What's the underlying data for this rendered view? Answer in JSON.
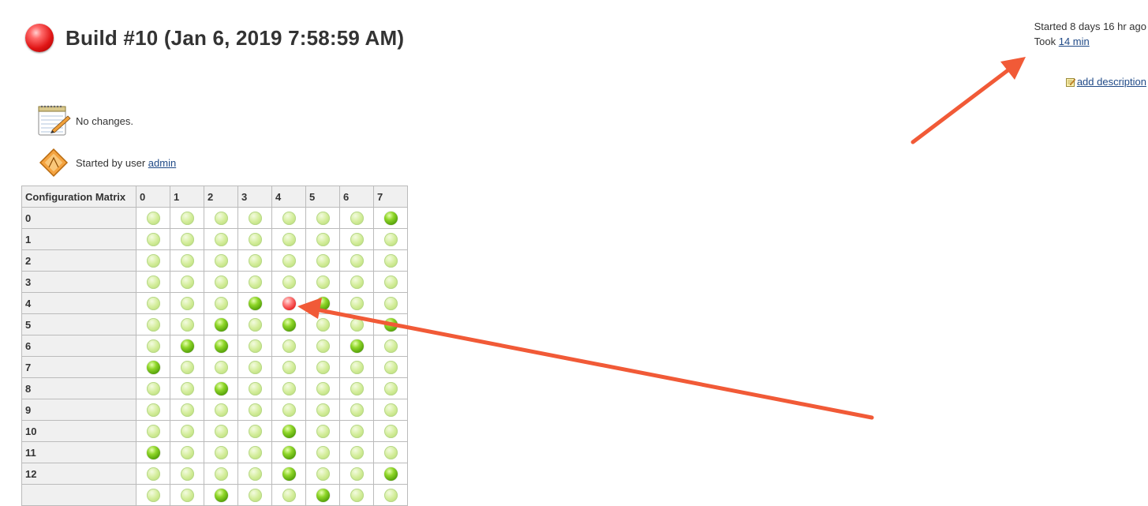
{
  "build": {
    "title": "Build #10 (Jan 6, 2019 7:58:59 AM)",
    "status": "failed",
    "started": "Started 8 days 16 hr ago",
    "took_prefix": "Took",
    "duration": "14 min",
    "add_description": "add description"
  },
  "changes": {
    "text": "No changes.",
    "icon": "notepad-icon"
  },
  "cause": {
    "prefix": "Started by user",
    "user": "admin",
    "icon": "user-cause-icon"
  },
  "matrix": {
    "corner_label": "Configuration Matrix",
    "columns": [
      "0",
      "1",
      "2",
      "3",
      "4",
      "5",
      "6",
      "7"
    ],
    "rows": [
      {
        "label": "0",
        "cells": [
          "light",
          "light",
          "light",
          "light",
          "light",
          "light",
          "light",
          "green"
        ]
      },
      {
        "label": "1",
        "cells": [
          "light",
          "light",
          "light",
          "light",
          "light",
          "light",
          "light",
          "light"
        ]
      },
      {
        "label": "2",
        "cells": [
          "light",
          "light",
          "light",
          "light",
          "light",
          "light",
          "light",
          "light"
        ]
      },
      {
        "label": "3",
        "cells": [
          "light",
          "light",
          "light",
          "light",
          "light",
          "light",
          "light",
          "light"
        ]
      },
      {
        "label": "4",
        "cells": [
          "light",
          "light",
          "light",
          "green",
          "red",
          "green",
          "light",
          "light"
        ]
      },
      {
        "label": "5",
        "cells": [
          "light",
          "light",
          "green",
          "light",
          "green",
          "light",
          "light",
          "green"
        ]
      },
      {
        "label": "6",
        "cells": [
          "light",
          "green",
          "green",
          "light",
          "light",
          "light",
          "green",
          "light"
        ]
      },
      {
        "label": "7",
        "cells": [
          "green",
          "light",
          "light",
          "light",
          "light",
          "light",
          "light",
          "light"
        ]
      },
      {
        "label": "8",
        "cells": [
          "light",
          "light",
          "green",
          "light",
          "light",
          "light",
          "light",
          "light"
        ]
      },
      {
        "label": "9",
        "cells": [
          "light",
          "light",
          "light",
          "light",
          "light",
          "light",
          "light",
          "light"
        ]
      },
      {
        "label": "10",
        "cells": [
          "light",
          "light",
          "light",
          "light",
          "green",
          "light",
          "light",
          "light"
        ]
      },
      {
        "label": "11",
        "cells": [
          "green",
          "light",
          "light",
          "light",
          "green",
          "light",
          "light",
          "light"
        ]
      },
      {
        "label": "12",
        "cells": [
          "light",
          "light",
          "light",
          "light",
          "green",
          "light",
          "light",
          "green"
        ]
      },
      {
        "label": "",
        "cells": [
          "light",
          "light",
          "green",
          "light",
          "light",
          "green",
          "light",
          "light"
        ]
      }
    ]
  },
  "colors": {
    "link": "#204a87",
    "annotation_arrow": "#f15a37",
    "header_bg": "#f0f0f0",
    "failed_ball": "#e01515",
    "success_ball": "#4e9b06"
  }
}
